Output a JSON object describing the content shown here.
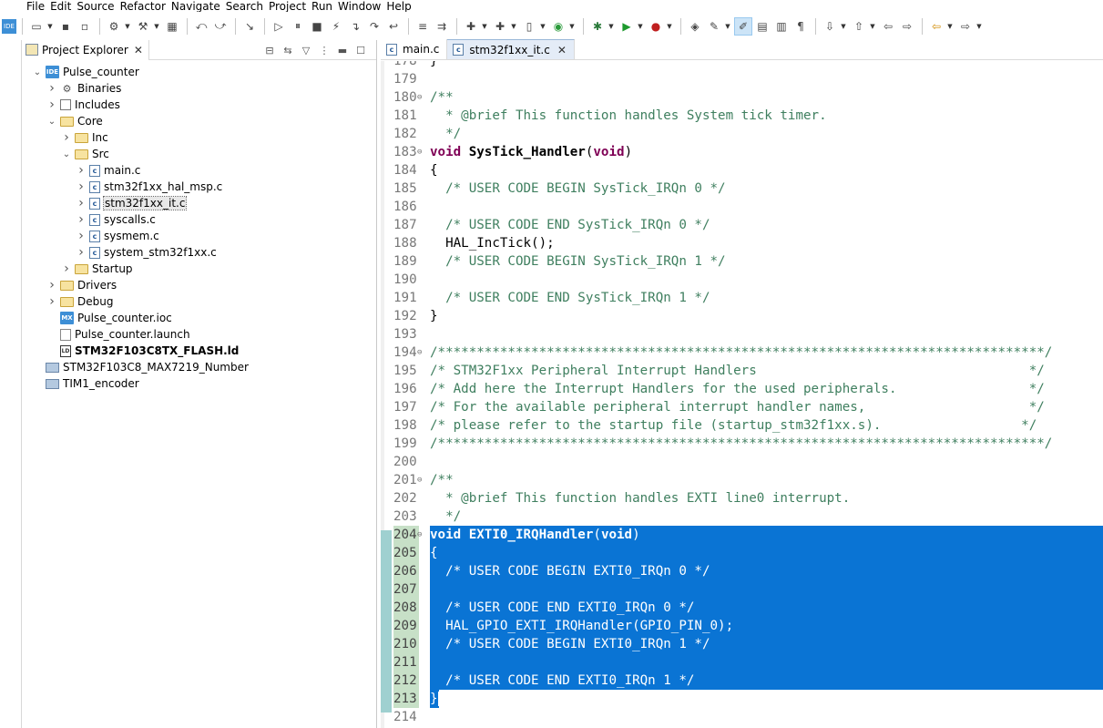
{
  "menu": [
    "File",
    "Edit",
    "Source",
    "Refactor",
    "Navigate",
    "Search",
    "Project",
    "Run",
    "Window",
    "Help"
  ],
  "explorer": {
    "title": "Project Explorer",
    "tree": [
      {
        "label": "Pulse_counter",
        "depth": 0,
        "twisty": "open",
        "icon": "project",
        "icon_text": "IDE",
        "name": "tree-item-pulse-counter"
      },
      {
        "label": "Binaries",
        "depth": 1,
        "twisty": "closed",
        "icon": "bin",
        "icon_text": "",
        "name": "tree-item-binaries"
      },
      {
        "label": "Includes",
        "depth": 1,
        "twisty": "closed",
        "icon": "inc",
        "icon_text": "",
        "name": "tree-item-includes"
      },
      {
        "label": "Core",
        "depth": 1,
        "twisty": "open",
        "icon": "folder-open",
        "icon_text": "",
        "name": "tree-item-core"
      },
      {
        "label": "Inc",
        "depth": 2,
        "twisty": "closed",
        "icon": "folder-open",
        "icon_text": "",
        "name": "tree-item-inc"
      },
      {
        "label": "Src",
        "depth": 2,
        "twisty": "open",
        "icon": "folder-open",
        "icon_text": "",
        "name": "tree-item-src"
      },
      {
        "label": "main.c",
        "depth": 3,
        "twisty": "closed",
        "icon": "cfile",
        "icon_text": "c",
        "name": "tree-item-main-c"
      },
      {
        "label": "stm32f1xx_hal_msp.c",
        "depth": 3,
        "twisty": "closed",
        "icon": "cfile",
        "icon_text": "c",
        "name": "tree-item-hal-msp-c"
      },
      {
        "label": "stm32f1xx_it.c",
        "depth": 3,
        "twisty": "closed",
        "icon": "cfile",
        "icon_text": "c",
        "name": "tree-item-it-c",
        "selected": true
      },
      {
        "label": "syscalls.c",
        "depth": 3,
        "twisty": "closed",
        "icon": "cfile",
        "icon_text": "c",
        "name": "tree-item-syscalls-c"
      },
      {
        "label": "sysmem.c",
        "depth": 3,
        "twisty": "closed",
        "icon": "cfile",
        "icon_text": "c",
        "name": "tree-item-sysmem-c"
      },
      {
        "label": "system_stm32f1xx.c",
        "depth": 3,
        "twisty": "closed",
        "icon": "cfile",
        "icon_text": "c",
        "name": "tree-item-system-c"
      },
      {
        "label": "Startup",
        "depth": 2,
        "twisty": "closed",
        "icon": "folder-open",
        "icon_text": "",
        "name": "tree-item-startup"
      },
      {
        "label": "Drivers",
        "depth": 1,
        "twisty": "closed",
        "icon": "folder-open",
        "icon_text": "",
        "name": "tree-item-drivers"
      },
      {
        "label": "Debug",
        "depth": 1,
        "twisty": "closed",
        "icon": "folder-open",
        "icon_text": "",
        "name": "tree-item-debug"
      },
      {
        "label": "Pulse_counter.ioc",
        "depth": 1,
        "twisty": "none",
        "icon": "mx",
        "icon_text": "MX",
        "name": "tree-item-ioc"
      },
      {
        "label": "Pulse_counter.launch",
        "depth": 1,
        "twisty": "none",
        "icon": "launch",
        "icon_text": "",
        "name": "tree-item-launch"
      },
      {
        "label": "STM32F103C8TX_FLASH.ld",
        "depth": 1,
        "twisty": "none",
        "icon": "ld",
        "icon_text": "LD",
        "name": "tree-item-ld",
        "bold": true
      },
      {
        "label": "STM32F103C8_MAX7219_Number",
        "depth": 0,
        "twisty": "none",
        "icon": "closedproj",
        "icon_text": "",
        "name": "tree-item-max7219-project"
      },
      {
        "label": "TIM1_encoder",
        "depth": 0,
        "twisty": "none",
        "icon": "closedproj",
        "icon_text": "",
        "name": "tree-item-tim1-encoder"
      }
    ]
  },
  "editor": {
    "tabs": [
      {
        "label": "main.c",
        "active": false
      },
      {
        "label": "stm32f1xx_it.c",
        "active": true
      }
    ],
    "lines": [
      {
        "n": "178",
        "fold": "",
        "segs": [
          [
            "",
            "}"
          ]
        ]
      },
      {
        "n": "179",
        "fold": "",
        "segs": []
      },
      {
        "n": "180",
        "fold": "⊖",
        "segs": [
          [
            "cm",
            "/**"
          ]
        ]
      },
      {
        "n": "181",
        "fold": "",
        "segs": [
          [
            "cm",
            "  * @brief This function handles System tick timer."
          ]
        ]
      },
      {
        "n": "182",
        "fold": "",
        "segs": [
          [
            "cm",
            "  */"
          ]
        ]
      },
      {
        "n": "183",
        "fold": "⊖",
        "segs": [
          [
            "kw",
            "void"
          ],
          [
            "",
            " "
          ],
          [
            "fn",
            "SysTick_Handler"
          ],
          [
            "",
            "("
          ],
          [
            "kw",
            "void"
          ],
          [
            "",
            ")"
          ]
        ]
      },
      {
        "n": "184",
        "fold": "",
        "segs": [
          [
            "",
            "{"
          ]
        ]
      },
      {
        "n": "185",
        "fold": "",
        "segs": [
          [
            "cm",
            "  /* USER CODE BEGIN SysTick_IRQn 0 */"
          ]
        ]
      },
      {
        "n": "186",
        "fold": "",
        "segs": []
      },
      {
        "n": "187",
        "fold": "",
        "segs": [
          [
            "cm",
            "  /* USER CODE END SysTick_IRQn 0 */"
          ]
        ]
      },
      {
        "n": "188",
        "fold": "",
        "segs": [
          [
            "",
            "  HAL_IncTick();"
          ]
        ]
      },
      {
        "n": "189",
        "fold": "",
        "segs": [
          [
            "cm",
            "  /* USER CODE BEGIN SysTick_IRQn 1 */"
          ]
        ]
      },
      {
        "n": "190",
        "fold": "",
        "segs": []
      },
      {
        "n": "191",
        "fold": "",
        "segs": [
          [
            "cm",
            "  /* USER CODE END SysTick_IRQn 1 */"
          ]
        ]
      },
      {
        "n": "192",
        "fold": "",
        "segs": [
          [
            "",
            "}"
          ]
        ]
      },
      {
        "n": "193",
        "fold": "",
        "segs": []
      },
      {
        "n": "194",
        "fold": "⊖",
        "segs": [
          [
            "cm",
            "/******************************************************************************/"
          ]
        ]
      },
      {
        "n": "195",
        "fold": "",
        "segs": [
          [
            "cm",
            "/* STM32F1xx Peripheral Interrupt Handlers                                   */"
          ]
        ]
      },
      {
        "n": "196",
        "fold": "",
        "segs": [
          [
            "cm",
            "/* Add here the Interrupt Handlers for the used peripherals.                 */"
          ]
        ]
      },
      {
        "n": "197",
        "fold": "",
        "segs": [
          [
            "cm",
            "/* For the available peripheral interrupt handler names,                     */"
          ]
        ]
      },
      {
        "n": "198",
        "fold": "",
        "segs": [
          [
            "cm",
            "/* please refer to the startup file (startup_stm32f1xx.s).                  */"
          ]
        ]
      },
      {
        "n": "199",
        "fold": "",
        "segs": [
          [
            "cm",
            "/******************************************************************************/"
          ]
        ]
      },
      {
        "n": "200",
        "fold": "",
        "segs": []
      },
      {
        "n": "201",
        "fold": "⊖",
        "segs": [
          [
            "cm",
            "/**"
          ]
        ]
      },
      {
        "n": "202",
        "fold": "",
        "segs": [
          [
            "cm",
            "  * @brief This function handles EXTI line0 interrupt."
          ]
        ]
      },
      {
        "n": "203",
        "fold": "",
        "segs": [
          [
            "cm",
            "  */"
          ]
        ]
      },
      {
        "n": "204",
        "fold": "⊖",
        "sel": true,
        "segs": [
          [
            "kw",
            "void"
          ],
          [
            "",
            " "
          ],
          [
            "fn",
            "EXTI0_IRQHandler"
          ],
          [
            "",
            "("
          ],
          [
            "kw",
            "void"
          ],
          [
            "",
            ")"
          ]
        ]
      },
      {
        "n": "205",
        "fold": "",
        "sel": true,
        "segs": [
          [
            "",
            "{"
          ]
        ]
      },
      {
        "n": "206",
        "fold": "",
        "sel": true,
        "segs": [
          [
            "cm",
            "  /* USER CODE BEGIN EXTI0_IRQn 0 */"
          ]
        ]
      },
      {
        "n": "207",
        "fold": "",
        "sel": true,
        "segs": []
      },
      {
        "n": "208",
        "fold": "",
        "sel": true,
        "segs": [
          [
            "cm",
            "  /* USER CODE END EXTI0_IRQn 0 */"
          ]
        ]
      },
      {
        "n": "209",
        "fold": "",
        "sel": true,
        "segs": [
          [
            "",
            "  HAL_GPIO_EXTI_IRQHandler(GPIO_PIN_0);"
          ]
        ]
      },
      {
        "n": "210",
        "fold": "",
        "sel": true,
        "segs": [
          [
            "cm",
            "  /* USER CODE BEGIN EXTI0_IRQn 1 */"
          ]
        ]
      },
      {
        "n": "211",
        "fold": "",
        "sel": true,
        "segs": []
      },
      {
        "n": "212",
        "fold": "",
        "sel": true,
        "segs": [
          [
            "cm",
            "  /* USER CODE END EXTI0_IRQn 1 */"
          ]
        ]
      },
      {
        "n": "213",
        "fold": "",
        "sel": "partial",
        "segs": [
          [
            "",
            "}"
          ]
        ]
      },
      {
        "n": "214",
        "fold": "",
        "segs": []
      }
    ]
  },
  "colors": {
    "selection": "#0a74d4",
    "keyword": "#7f0055",
    "comment": "#3f7f5f",
    "line_number": "#787878"
  }
}
